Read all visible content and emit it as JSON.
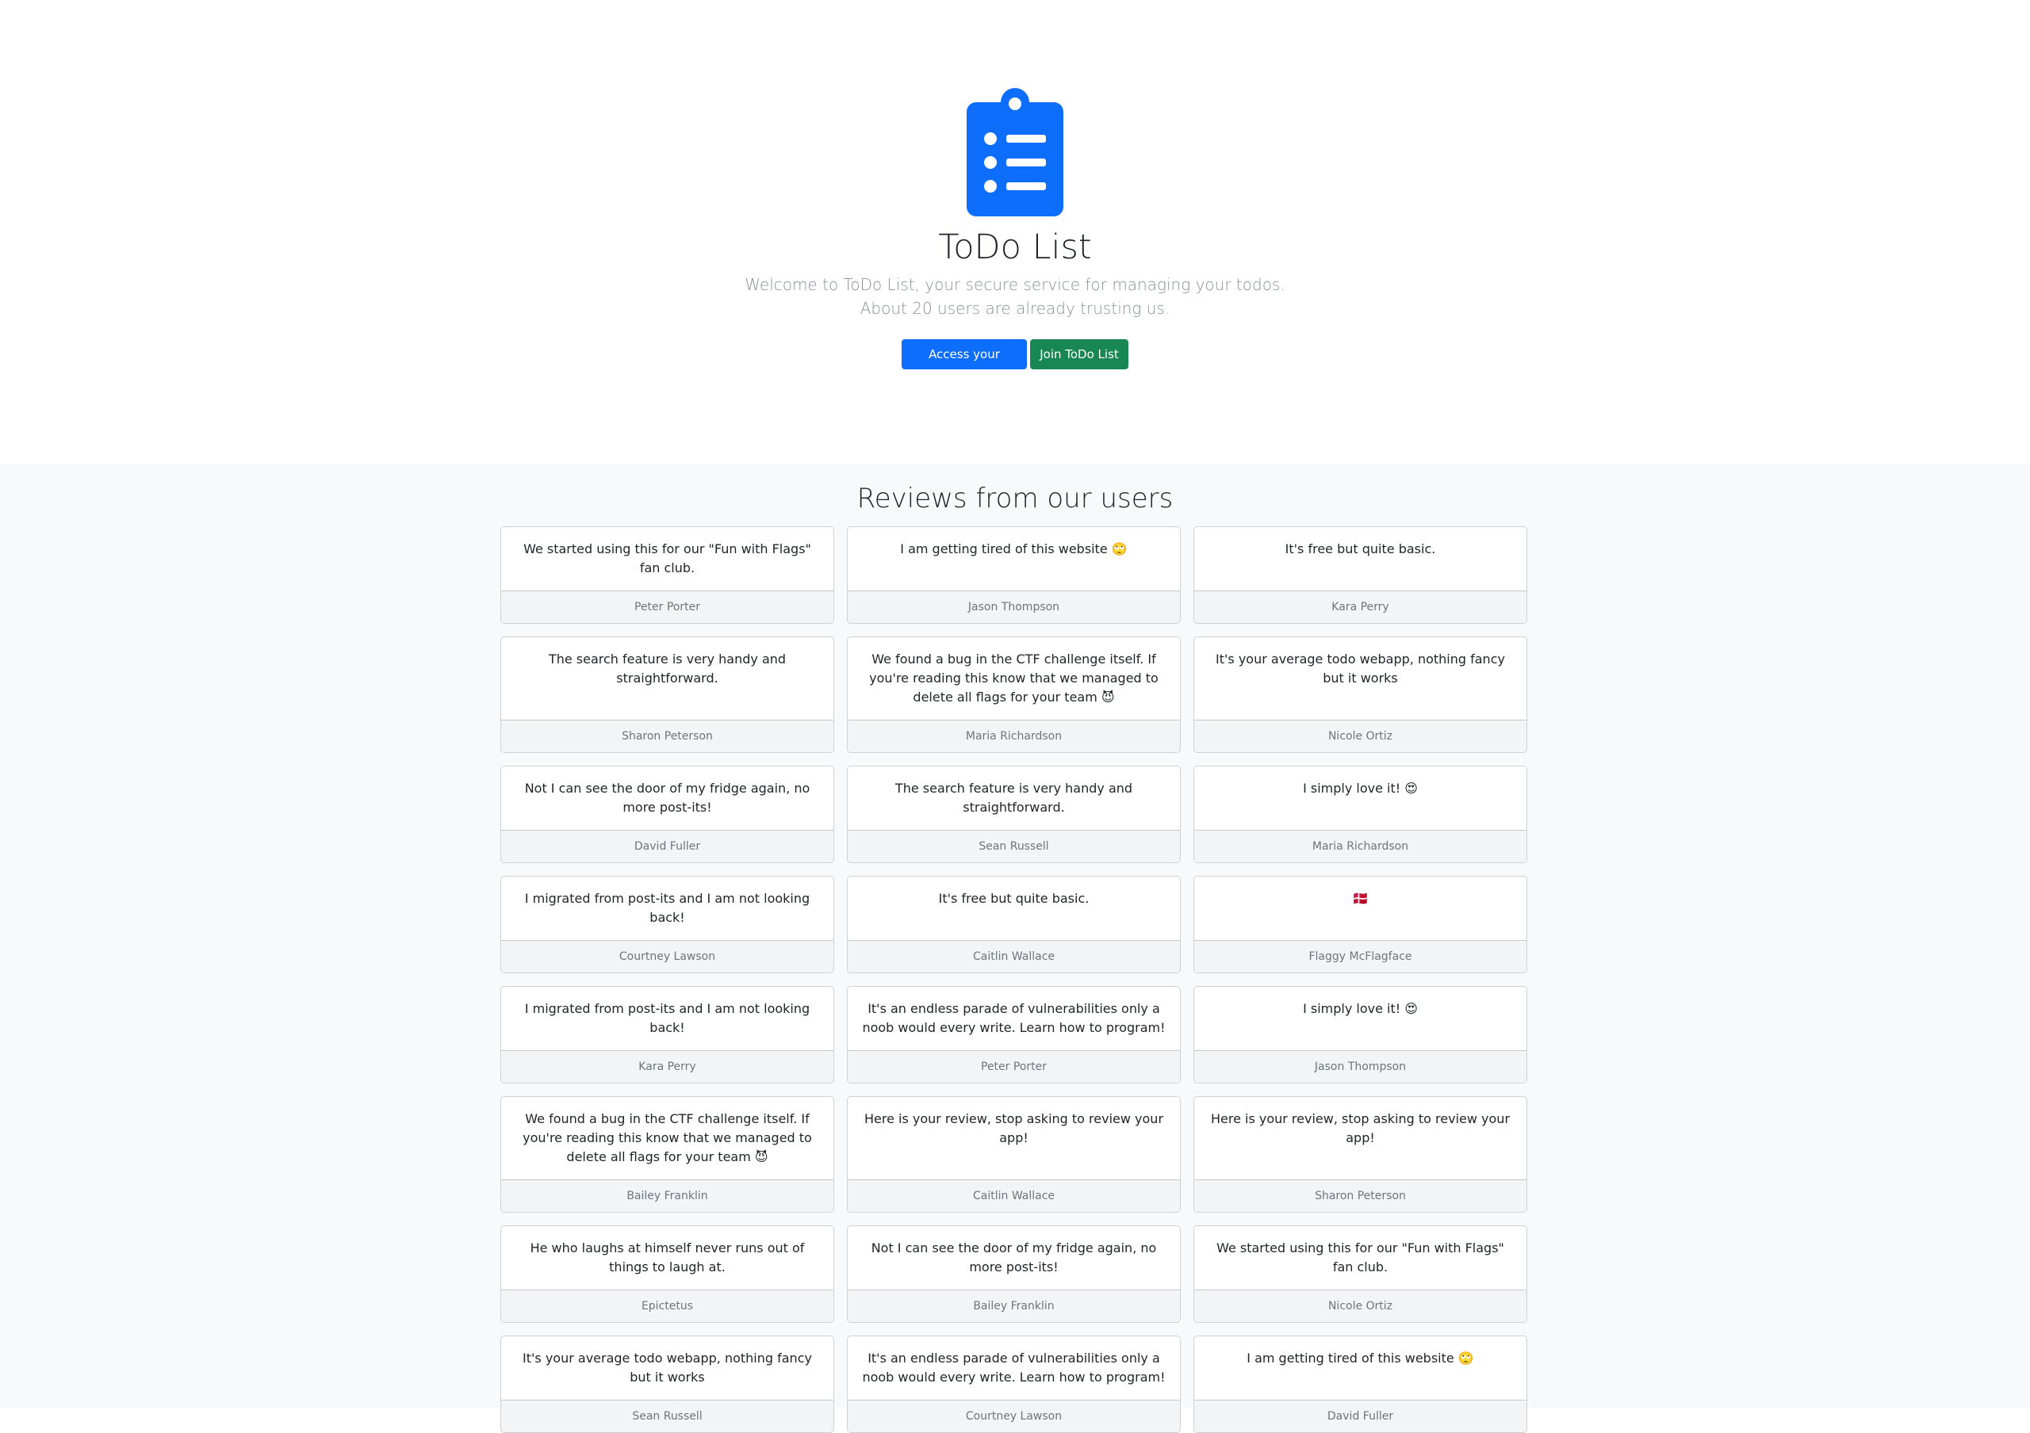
{
  "app": {
    "title": "ToDo List",
    "lead_line1": "Welcome to ToDo List, your secure service for managing your todos.",
    "lead_line2": "About 20 users are already trusting us.",
    "access_button": "Access your ToDos",
    "join_button": "Join ToDo List",
    "logo_icon": "clipboard-list-icon"
  },
  "colors": {
    "primary": "#0d6efd",
    "success": "#198754",
    "section_bg": "#f8f9fa"
  },
  "reviews": {
    "title": "Reviews from our users",
    "rows": [
      [
        {
          "text": "We started using this for our \"Fun with Flags\" fan club.",
          "author": "Peter Porter"
        },
        {
          "text": "I am getting tired of this website 🙄",
          "author": "Jason Thompson"
        },
        {
          "text": "It's free but quite basic.",
          "author": "Kara Perry"
        }
      ],
      [
        {
          "text": "The search feature is very handy and straightforward.",
          "author": "Sharon Peterson"
        },
        {
          "text": "We found a bug in the CTF challenge itself. If you're reading this know that we managed to delete all flags for your team 😈",
          "author": "Maria Richardson"
        },
        {
          "text": "It's your average todo webapp, nothing fancy but it works",
          "author": "Nicole Ortiz"
        }
      ],
      [
        {
          "text": "Not I can see the door of my fridge again, no more post-its!",
          "author": "David Fuller"
        },
        {
          "text": "The search feature is very handy and straightforward.",
          "author": "Sean Russell"
        },
        {
          "text": "I simply love it! 😍",
          "author": "Maria Richardson"
        }
      ],
      [
        {
          "text": "I migrated from post-its and I am not looking back!",
          "author": "Courtney Lawson"
        },
        {
          "text": "It's free but quite basic.",
          "author": "Caitlin Wallace"
        },
        {
          "text": "🇩🇰",
          "author": "Flaggy McFlagface"
        }
      ],
      [
        {
          "text": "I migrated from post-its and I am not looking back!",
          "author": "Kara Perry"
        },
        {
          "text": "It's an endless parade of vulnerabilities only a noob would every write. Learn how to program!",
          "author": "Peter Porter"
        },
        {
          "text": "I simply love it! 😍",
          "author": "Jason Thompson"
        }
      ],
      [
        {
          "text": "We found a bug in the CTF challenge itself. If you're reading this know that we managed to delete all flags for your team 😈",
          "author": "Bailey Franklin"
        },
        {
          "text": "Here is your review, stop asking to review your app!",
          "author": "Caitlin Wallace"
        },
        {
          "text": "Here is your review, stop asking to review your app!",
          "author": "Sharon Peterson"
        }
      ],
      [
        {
          "text": "He who laughs at himself never runs out of things to laugh at.",
          "author": "Epictetus"
        },
        {
          "text": "Not I can see the door of my fridge again, no more post-its!",
          "author": "Bailey Franklin"
        },
        {
          "text": "We started using this for our \"Fun with Flags\" fan club.",
          "author": "Nicole Ortiz"
        }
      ],
      [
        {
          "text": "It's your average todo webapp, nothing fancy but it works",
          "author": "Sean Russell"
        },
        {
          "text": "It's an endless parade of vulnerabilities only a noob would every write. Learn how to program!",
          "author": "Courtney Lawson"
        },
        {
          "text": "I am getting tired of this website 🙄",
          "author": "David Fuller"
        }
      ]
    ]
  }
}
